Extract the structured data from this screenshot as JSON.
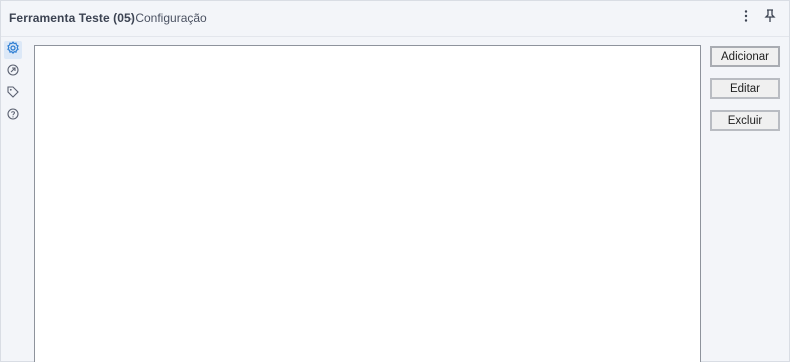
{
  "header": {
    "tool_name": "Ferramenta Teste (05)",
    "section": "- Configuração"
  },
  "icons": {
    "menu": "more-vertical-icon",
    "pin": "pin-icon",
    "config": "gear-icon",
    "navigate": "arrow-circle-icon",
    "annotation": "tag-icon",
    "help": "help-circle-icon"
  },
  "colors": {
    "active_icon": "#2f7fd3",
    "icon": "#5a6070"
  },
  "buttons": {
    "add": "Adicionar",
    "edit": "Editar",
    "delete": "Excluir"
  }
}
